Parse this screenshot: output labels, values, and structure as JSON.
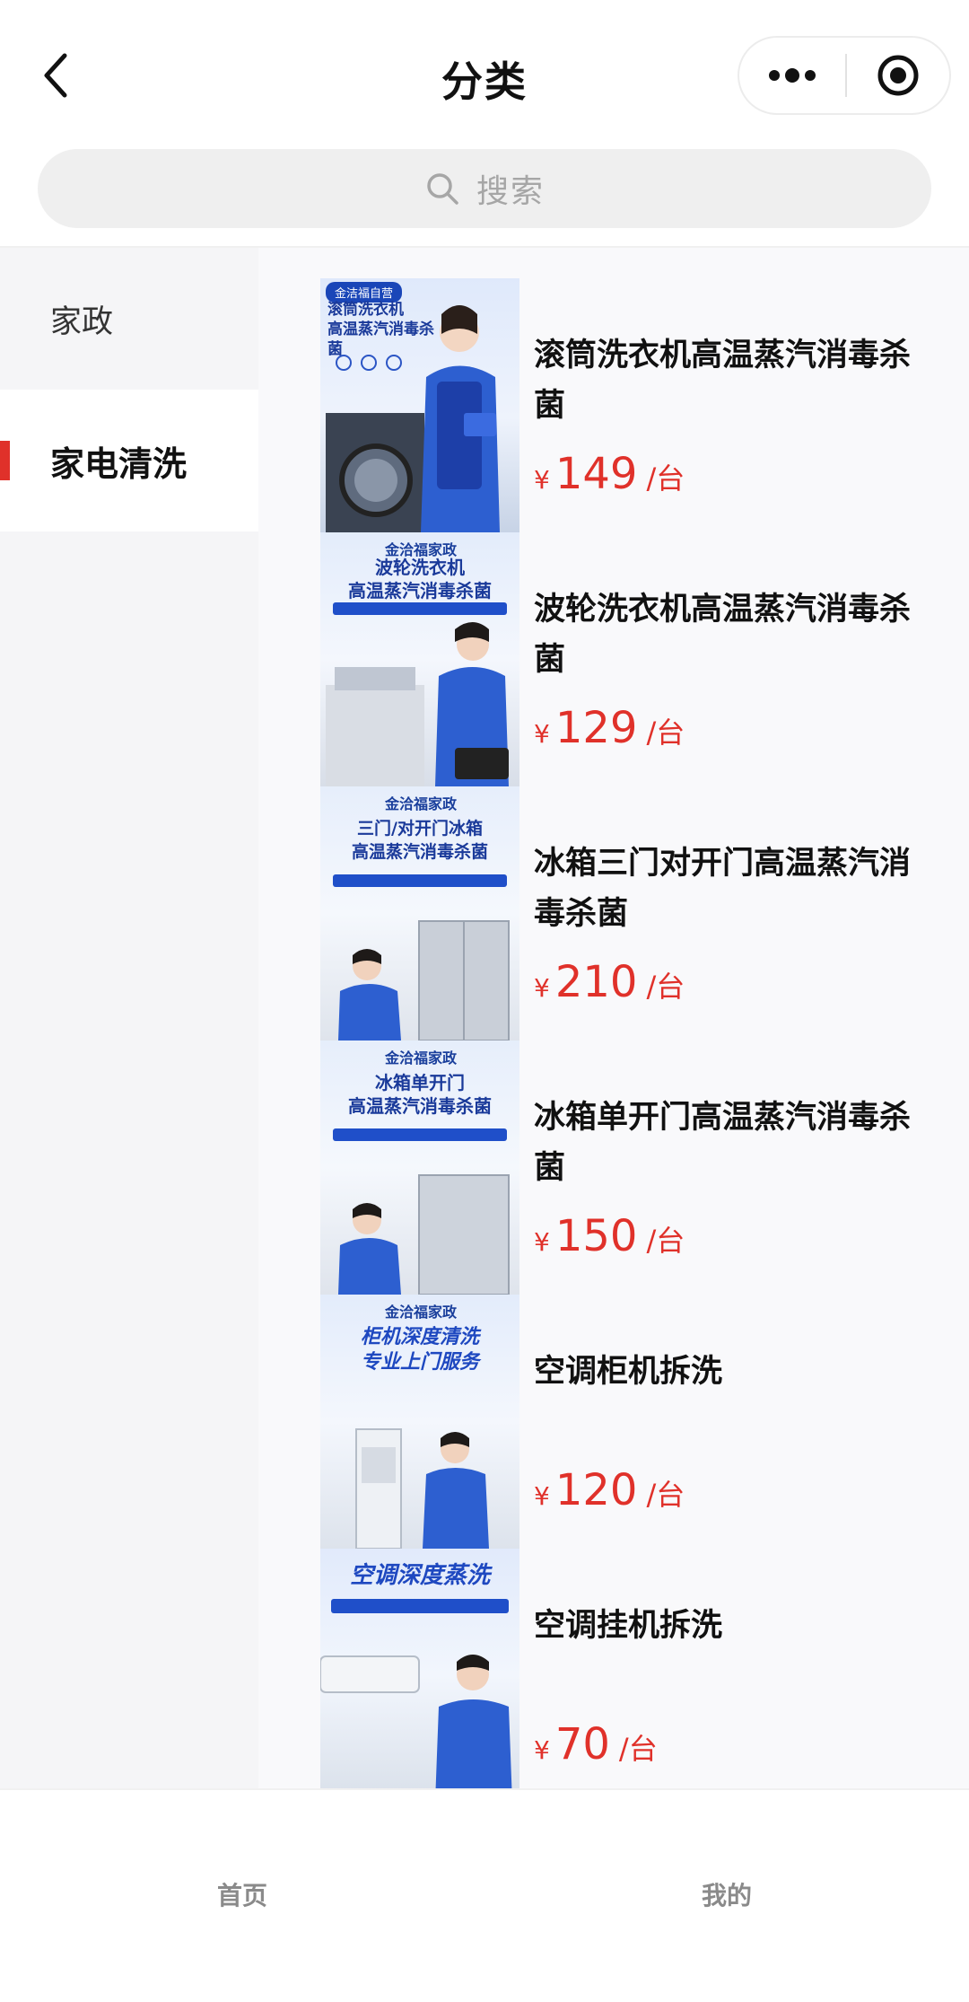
{
  "header": {
    "title": "分类",
    "back_icon": "chevron-left-icon",
    "more_icon": "more-dots-icon",
    "target_icon": "record-target-icon"
  },
  "search": {
    "placeholder": "搜索",
    "icon": "search-icon"
  },
  "sidebar": {
    "items": [
      {
        "label": "家政",
        "active": false
      },
      {
        "label": "家电清洗",
        "active": true
      }
    ],
    "active_color": "#e0312a"
  },
  "products": [
    {
      "name": "滚筒洗衣机高温蒸汽消毒杀菌",
      "currency": "¥",
      "price": "149",
      "unit": "/台",
      "thumb_brand": "金洁福自营",
      "thumb_headline": "滚筒洗衣机\n高温蒸汽消毒杀菌"
    },
    {
      "name": "波轮洗衣机高温蒸汽消毒杀菌",
      "currency": "¥",
      "price": "129",
      "unit": "/台",
      "thumb_brand": "金洽福家政",
      "thumb_headline": "波轮洗衣机\n高温蒸汽消毒杀菌"
    },
    {
      "name": "冰箱三门对开门高温蒸汽消毒杀菌",
      "currency": "¥",
      "price": "210",
      "unit": "/台",
      "thumb_brand": "金洽福家政",
      "thumb_headline": "三门/对开门冰箱\n高温蒸汽消毒杀菌"
    },
    {
      "name": "冰箱单开门高温蒸汽消毒杀菌",
      "currency": "¥",
      "price": "150",
      "unit": "/台",
      "thumb_brand": "金洽福家政",
      "thumb_headline": "冰箱单开门\n高温蒸汽消毒杀菌"
    },
    {
      "name": "空调柜机拆洗",
      "currency": "¥",
      "price": "120",
      "unit": "/台",
      "thumb_brand": "金洽福家政",
      "thumb_headline": "柜机深度清洗\n专业上门服务"
    },
    {
      "name": "空调挂机拆洗",
      "currency": "¥",
      "price": "70",
      "unit": "/台",
      "thumb_brand": "",
      "thumb_headline": "空调深度蒸洗"
    }
  ],
  "tabbar": {
    "items": [
      {
        "label": "首页"
      },
      {
        "label": "我的"
      }
    ]
  },
  "colors": {
    "price": "#e0312a",
    "thumb_blue": "#1a46b8"
  }
}
